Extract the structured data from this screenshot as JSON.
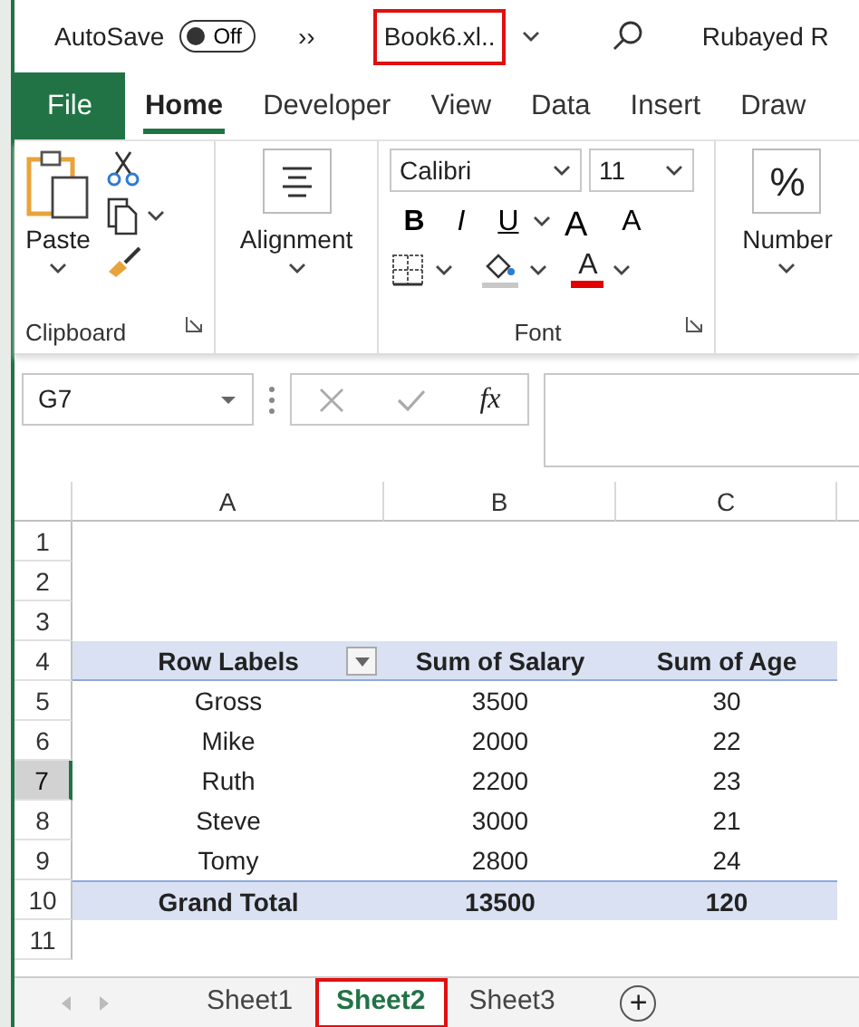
{
  "title_bar": {
    "autosave_label": "AutoSave",
    "autosave_toggle": {
      "label": "Off",
      "on": false
    },
    "overflow": "››",
    "file_name": {
      "text": "Book6.xl..",
      "highlighted": true
    },
    "user": "Rubayed R"
  },
  "ribbon_tabs": [
    {
      "label": "File",
      "kind": "file",
      "selected": false
    },
    {
      "label": "Home",
      "kind": "tab",
      "selected": true
    },
    {
      "label": "Developer",
      "kind": "tab",
      "selected": false
    },
    {
      "label": "View",
      "kind": "tab",
      "selected": false
    },
    {
      "label": "Data",
      "kind": "tab",
      "selected": false
    },
    {
      "label": "Insert",
      "kind": "tab",
      "selected": false
    },
    {
      "label": "Draw",
      "kind": "tab",
      "selected": false
    }
  ],
  "ribbon": {
    "clipboard": {
      "paste": "Paste",
      "group": "Clipboard"
    },
    "alignment": {
      "label": "Alignment"
    },
    "font": {
      "name": "Calibri",
      "size": "11",
      "bold": "B",
      "italic": "I",
      "underline": "U",
      "grow": "A",
      "shrink": "A",
      "font_color": "A",
      "group": "Font"
    },
    "number": {
      "symbol": "%",
      "label": "Number"
    }
  },
  "formula_bar": {
    "name_box": "G7",
    "fx": "fx"
  },
  "columns": [
    "A",
    "B",
    "C"
  ],
  "rows": [
    {
      "number": "1",
      "selected": false
    },
    {
      "number": "2",
      "selected": false
    },
    {
      "number": "3",
      "selected": false
    },
    {
      "number": "4",
      "selected": false,
      "kind": "header",
      "cells": [
        "Row Labels",
        "Sum of Salary",
        "Sum of Age"
      ]
    },
    {
      "number": "5",
      "selected": false,
      "kind": "data",
      "cells": [
        "Gross",
        "3500",
        "30"
      ]
    },
    {
      "number": "6",
      "selected": false,
      "kind": "data",
      "cells": [
        "Mike",
        "2000",
        "22"
      ]
    },
    {
      "number": "7",
      "selected": true,
      "kind": "data",
      "cells": [
        "Ruth",
        "2200",
        "23"
      ]
    },
    {
      "number": "8",
      "selected": false,
      "kind": "data",
      "cells": [
        "Steve",
        "3000",
        "21"
      ]
    },
    {
      "number": "9",
      "selected": false,
      "kind": "data",
      "cells": [
        "Tomy",
        "2800",
        "24"
      ]
    },
    {
      "number": "10",
      "selected": false,
      "kind": "total",
      "cells": [
        "Grand Total",
        "13500",
        "120"
      ]
    },
    {
      "number": "11",
      "selected": false
    }
  ],
  "sheet_tabs": [
    {
      "label": "Sheet1",
      "selected": false,
      "highlighted": false
    },
    {
      "label": "Sheet2",
      "selected": true,
      "highlighted": true
    },
    {
      "label": "Sheet3",
      "selected": false,
      "highlighted": false
    }
  ],
  "add_sheet": "+"
}
